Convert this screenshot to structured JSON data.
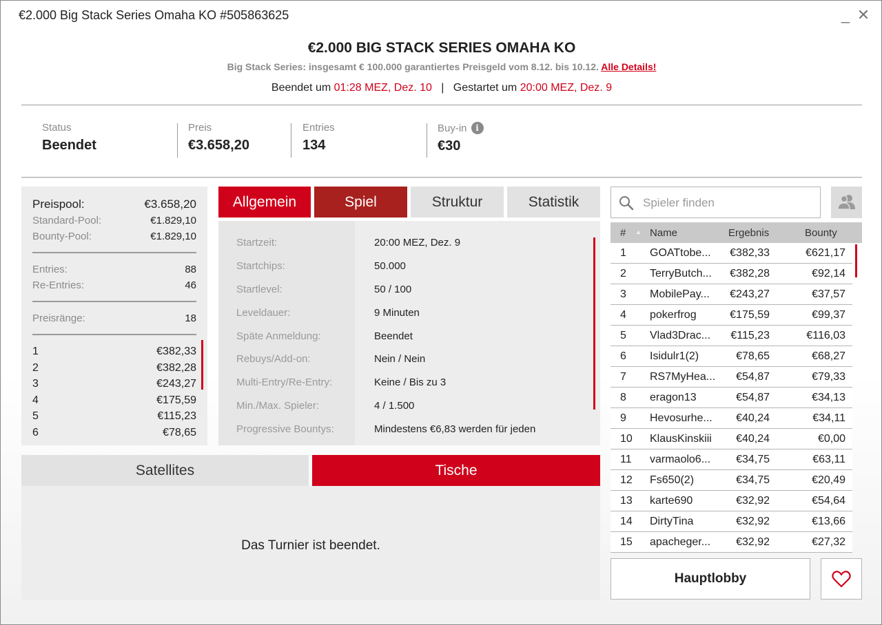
{
  "window": {
    "title": "€2.000 Big Stack Series Omaha KO #505863625",
    "minimize": "_",
    "close": "✕"
  },
  "header": {
    "title": "€2.000 BIG STACK SERIES OMAHA KO",
    "subtitle": "Big Stack Series: insgesamt € 100.000 garantiertes Preisgeld vom 8.12. bis 10.12.",
    "details_link": "Alle Details!",
    "ended_label": "Beendet um",
    "ended_value": "01:28 MEZ, Dez. 10",
    "divider": "|",
    "started_label": "Gestartet um",
    "started_value": "20:00 MEZ, Dez. 9"
  },
  "info": {
    "status_label": "Status",
    "status_value": "Beendet",
    "prize_label": "Preis",
    "prize_value": "€3.658,20",
    "entries_label": "Entries",
    "entries_value": "134",
    "buyin_label": "Buy-in",
    "buyin_value": "€30",
    "buyin_icon": "info-icon",
    "buyin_icon_glyph": "i"
  },
  "pool": {
    "prizepool_label": "Preispool:",
    "prizepool_value": "€3.658,20",
    "standard_label": "Standard-Pool:",
    "standard_value": "€1.829,10",
    "bounty_label": "Bounty-Pool:",
    "bounty_value": "€1.829,10",
    "entries_label": "Entries:",
    "entries_value": "88",
    "reentries_label": "Re-Entries:",
    "reentries_value": "46",
    "ranks_label": "Preisränge:",
    "ranks_value": "18",
    "places": [
      {
        "rank": "1",
        "value": "€382,33"
      },
      {
        "rank": "2",
        "value": "€382,28"
      },
      {
        "rank": "3",
        "value": "€243,27"
      },
      {
        "rank": "4",
        "value": "€175,59"
      },
      {
        "rank": "5",
        "value": "€115,23"
      },
      {
        "rank": "6",
        "value": "€78,65"
      }
    ]
  },
  "tabs": {
    "general": "Allgemein",
    "game": "Spiel",
    "structure": "Struktur",
    "statistics": "Statistik"
  },
  "details": [
    {
      "label": "Startzeit:",
      "value": "20:00 MEZ, Dez. 9"
    },
    {
      "label": "Startchips:",
      "value": "50.000"
    },
    {
      "label": "Startlevel:",
      "value": "50 / 100"
    },
    {
      "label": "Leveldauer:",
      "value": "9 Minuten"
    },
    {
      "label": "Späte Anmeldung:",
      "value": "Beendet"
    },
    {
      "label": "Rebuys/Add-on:",
      "value": "Nein / Nein"
    },
    {
      "label": "Multi-Entry/Re-Entry:",
      "value": "Keine / Bis zu 3"
    },
    {
      "label": "Min./Max. Spieler:",
      "value": "4 / 1.500"
    },
    {
      "label": "Progressive Bountys:",
      "value": "Mindestens €6,83 werden für jeden"
    }
  ],
  "lower_tabs": {
    "satellites": "Satellites",
    "tables": "Tische"
  },
  "lower_message": "Das Turnier ist beendet.",
  "search": {
    "placeholder": "Spieler finden"
  },
  "players": {
    "headers": {
      "rank": "#",
      "sort": "▲",
      "name": "Name",
      "result": "Ergebnis",
      "bounty": "Bounty"
    },
    "rows": [
      {
        "rank": "1",
        "name": "GOATtobe...",
        "result": "€382,33",
        "bounty": "€621,17"
      },
      {
        "rank": "2",
        "name": "TerryButch...",
        "result": "€382,28",
        "bounty": "€92,14"
      },
      {
        "rank": "3",
        "name": "MobilePay...",
        "result": "€243,27",
        "bounty": "€37,57"
      },
      {
        "rank": "4",
        "name": "pokerfrog",
        "result": "€175,59",
        "bounty": "€99,37"
      },
      {
        "rank": "5",
        "name": "Vlad3Drac...",
        "result": "€115,23",
        "bounty": "€116,03"
      },
      {
        "rank": "6",
        "name": "Isidulr1(2)",
        "result": "€78,65",
        "bounty": "€68,27"
      },
      {
        "rank": "7",
        "name": "RS7MyHea...",
        "result": "€54,87",
        "bounty": "€79,33"
      },
      {
        "rank": "8",
        "name": "eragon13",
        "result": "€54,87",
        "bounty": "€34,13"
      },
      {
        "rank": "9",
        "name": "Hevosurhe...",
        "result": "€40,24",
        "bounty": "€34,11"
      },
      {
        "rank": "10",
        "name": "KlausKinskiii",
        "result": "€40,24",
        "bounty": "€0,00"
      },
      {
        "rank": "11",
        "name": "varmaolo6...",
        "result": "€34,75",
        "bounty": "€63,11"
      },
      {
        "rank": "12",
        "name": "Fs650(2)",
        "result": "€34,75",
        "bounty": "€20,49"
      },
      {
        "rank": "13",
        "name": "karte690",
        "result": "€32,92",
        "bounty": "€54,64"
      },
      {
        "rank": "14",
        "name": "DirtyTina",
        "result": "€32,92",
        "bounty": "€13,66"
      },
      {
        "rank": "15",
        "name": "apacheger...",
        "result": "€32,92",
        "bounty": "€27,32"
      }
    ]
  },
  "buttons": {
    "main_lobby": "Hauptlobby",
    "favorite_icon": "heart-icon",
    "friends_icon": "friends-icon",
    "search_icon": "search-icon"
  },
  "colors": {
    "accent_red": "#d0021b",
    "dark_red": "#a8211f",
    "panel_gray": "#ededed"
  }
}
